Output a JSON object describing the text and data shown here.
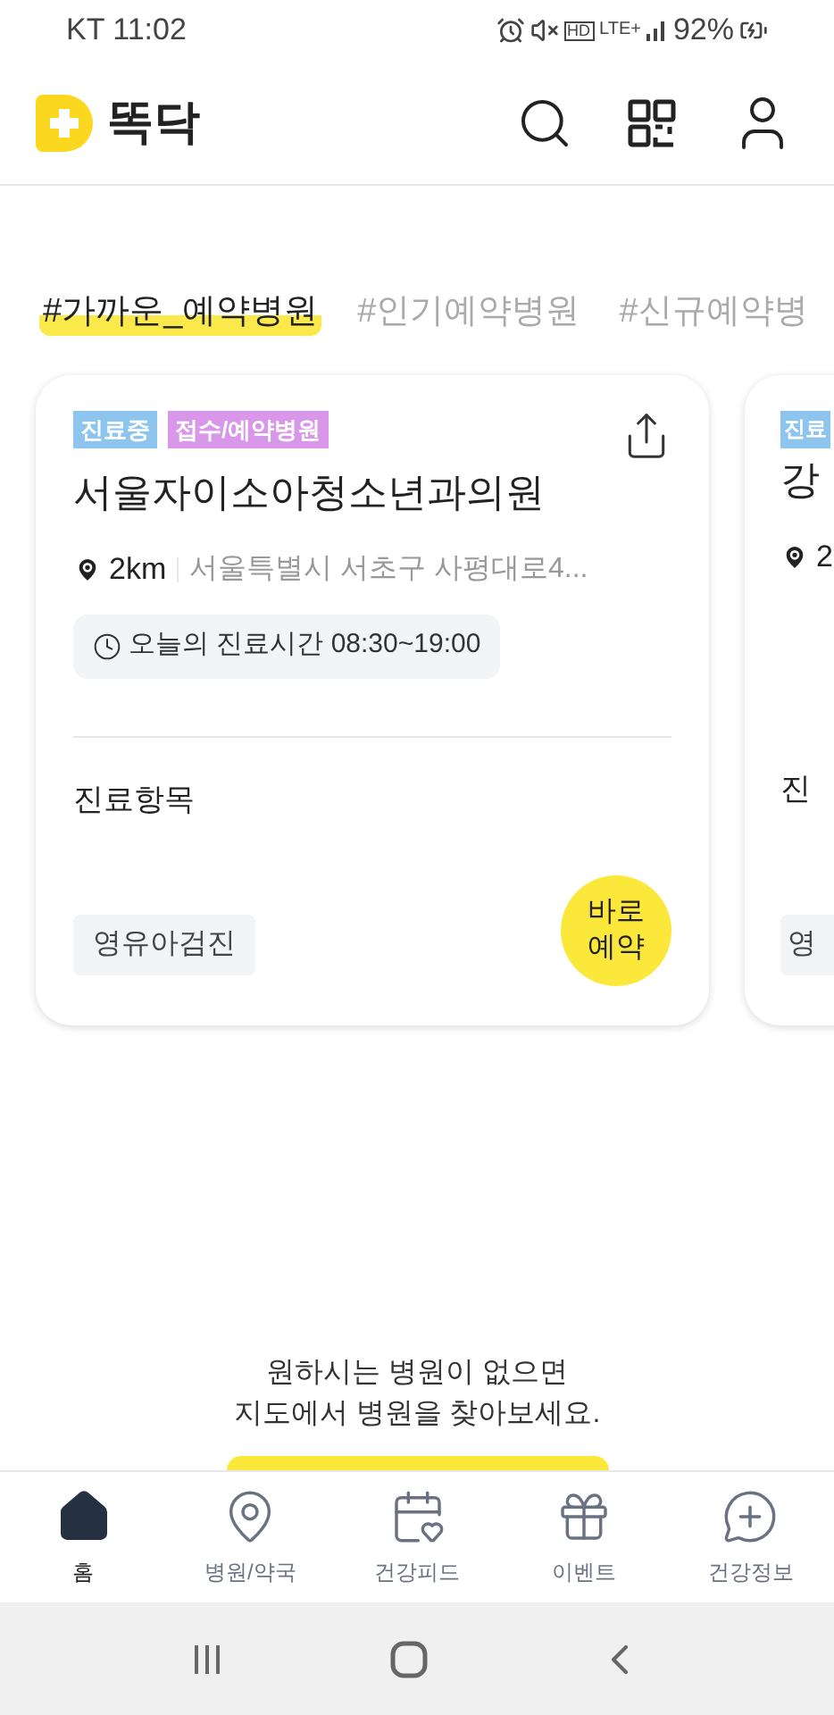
{
  "status_bar": {
    "carrier_time": "KT 11:02",
    "hd": "HD",
    "network": "LTE+",
    "battery": "92%"
  },
  "header": {
    "logo_text": "똑닥"
  },
  "tabs": [
    {
      "label": "#가까운_예약병원",
      "selected": true
    },
    {
      "label": "#인기예약병원",
      "selected": false
    },
    {
      "label": "#신규예약병",
      "selected": false
    }
  ],
  "cards": [
    {
      "tags": [
        {
          "label": "진료중",
          "color": "#8ec5ee"
        },
        {
          "label": "접수/예약병원",
          "color": "#d897e8"
        }
      ],
      "name": "서울자이소아청소년과의원",
      "distance": "2km",
      "address": "서울특별시 서초구 사평대로4...",
      "hours": "오늘의 진료시간 08:30~19:00",
      "section_title": "진료항목",
      "items": [
        "영유아검진"
      ],
      "book_button": "바로\n예약"
    },
    {
      "tags": [
        {
          "label": "진료",
          "color": "#8ec5ee"
        }
      ],
      "name": "강",
      "distance": "2",
      "section_title": "진",
      "items": [
        "영"
      ]
    }
  ],
  "map_prompt": "원하시는 병원이 없으면\n지도에서 병원을 찾아보세요.",
  "bottom_nav": [
    {
      "label": "홈",
      "kind": "home",
      "selected": true
    },
    {
      "label": "병원/약국",
      "kind": "pin",
      "selected": false
    },
    {
      "label": "건강피드",
      "kind": "calendar",
      "selected": false
    },
    {
      "label": "이벤트",
      "kind": "gift",
      "selected": false
    },
    {
      "label": "건강정보",
      "kind": "chat",
      "selected": false
    }
  ]
}
